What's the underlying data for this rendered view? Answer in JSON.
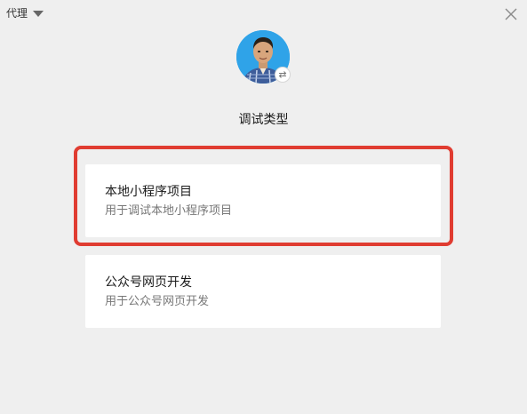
{
  "proxy": {
    "label": "代理",
    "icon": "caret-down-icon"
  },
  "window": {
    "close_icon": "close-icon"
  },
  "profile": {
    "avatar_icon": "user-avatar",
    "switch_icon": "switch-account-icon"
  },
  "section": {
    "title": "调试类型"
  },
  "options": [
    {
      "title": "本地小程序项目",
      "description": "用于调试本地小程序项目",
      "highlighted": true
    },
    {
      "title": "公众号网页开发",
      "description": "用于公众号网页开发",
      "highlighted": false
    }
  ],
  "colors": {
    "background": "#efefef",
    "card": "#ffffff",
    "highlight_border": "#e03c31",
    "avatar_bg": "#2fa3e8"
  }
}
